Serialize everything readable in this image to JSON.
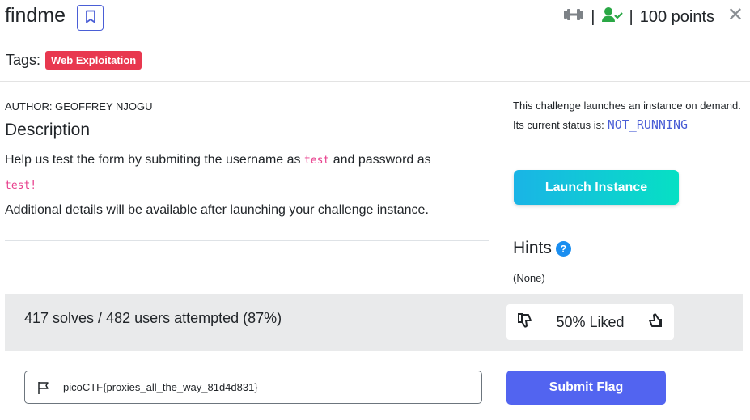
{
  "challenge": {
    "title": "findme",
    "points_text": "100 points",
    "separator": "|",
    "tags_label": "Tags:",
    "tags": [
      "Web Exploitation"
    ],
    "close_symbol": "✕"
  },
  "description": {
    "author": "AUTHOR: GEOFFREY NJOGU",
    "heading": "Description",
    "text_part1": "Help us test the form by submiting the username as ",
    "code_username": "test",
    "text_part2": " and password as ",
    "code_password": "test!",
    "text_part3": "Additional details will be available after launching your challenge instance."
  },
  "instance": {
    "info": "This challenge launches an instance on demand.",
    "status_label": "Its current status is:",
    "status_value": "NOT_RUNNING",
    "launch_label": "Launch Instance"
  },
  "hints": {
    "heading": "Hints",
    "help_symbol": "?",
    "value": "(None)"
  },
  "stats": {
    "solves_text": "417 solves / 482 users attempted (87%)",
    "liked_text": "50% Liked"
  },
  "flag": {
    "value": "picoCTF{proxies_all_the_way_81d4d831}",
    "submit_label": "Submit Flag"
  },
  "colors": {
    "tag_bg": "#e8384f",
    "accent": "#5264f0",
    "status": "#4a5ed6",
    "launch_gradient": [
      "#1ab4e6",
      "#06e0c4"
    ],
    "solved_green": "#2aa745"
  },
  "icons": {
    "bookmark": "bookmark-icon",
    "difficulty": "dumbbell-icon",
    "solved": "user-check-icon",
    "close": "close-icon",
    "help": "question-circle-icon",
    "dislike": "thumbs-down-icon",
    "like": "thumbs-up-icon",
    "flag": "flag-icon"
  }
}
